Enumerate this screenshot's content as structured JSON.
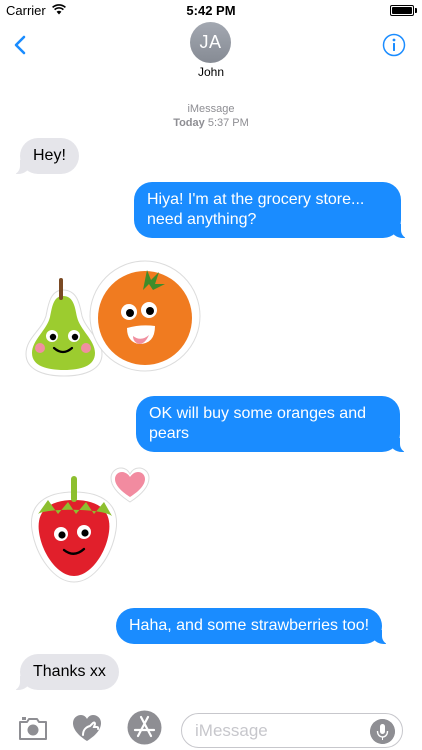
{
  "status_bar": {
    "carrier": "Carrier",
    "time": "5:42 PM"
  },
  "nav": {
    "contact_initials": "JA",
    "contact_name": "John"
  },
  "conversation": {
    "service": "iMessage",
    "day": "Today",
    "time": "5:37 PM"
  },
  "messages": [
    {
      "from": "them",
      "text": "Hey!"
    },
    {
      "from": "me",
      "line1": "Hiya! I'm at the grocery store...",
      "line2": "need anything?"
    },
    {
      "from": "them",
      "sticker": "pear-sticker"
    },
    {
      "from": "them",
      "sticker": "orange-sticker"
    },
    {
      "from": "me",
      "line1": "OK will buy some oranges and",
      "line2": "pears"
    },
    {
      "from": "them",
      "sticker": "strawberry-sticker"
    },
    {
      "from": "them",
      "sticker": "heart-sticker"
    },
    {
      "from": "me",
      "text": "Haha, and some strawberries too!"
    },
    {
      "from": "them",
      "text": "Thanks xx"
    }
  ],
  "input": {
    "placeholder": "iMessage"
  },
  "colors": {
    "accent": "#1a8cff",
    "incoming_bubble": "#e5e5ea",
    "outgoing_bubble": "#1a8cff",
    "icon_gray": "#8e8e93"
  },
  "icons": [
    "wifi-icon",
    "battery-icon",
    "back-chevron-icon",
    "info-icon",
    "camera-icon",
    "digital-touch-heart-icon",
    "app-store-icon",
    "microphone-icon"
  ]
}
